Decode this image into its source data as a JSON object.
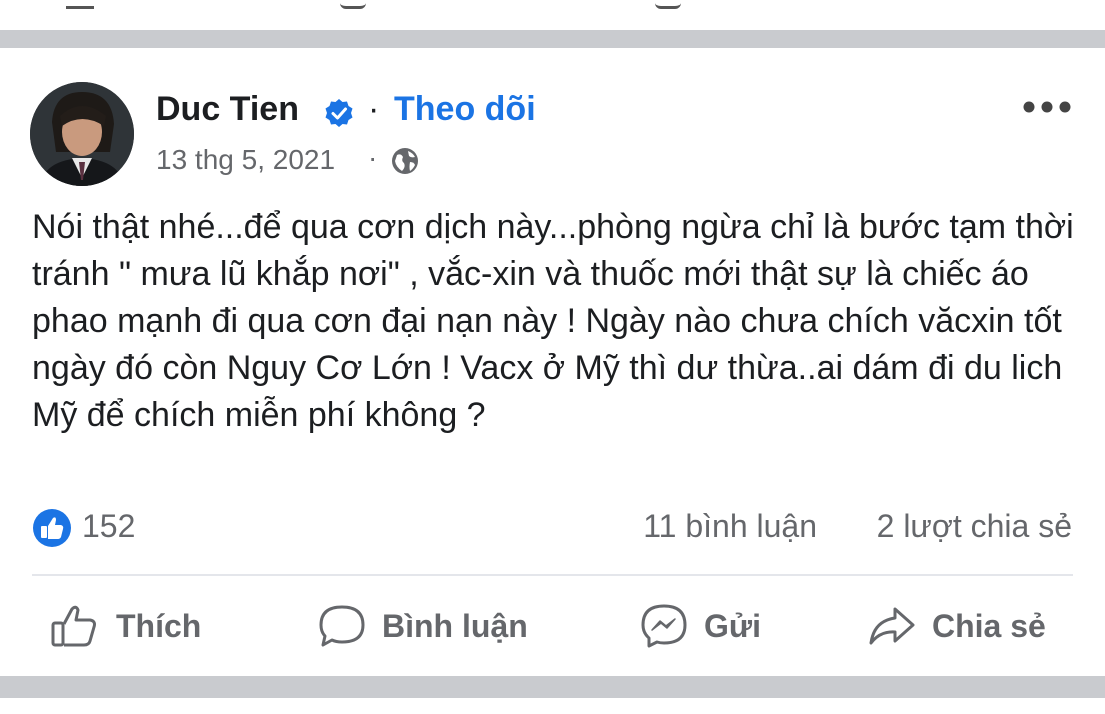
{
  "post": {
    "author": "Duc Tien",
    "follow_separator": "·",
    "follow_label": "Theo dõi",
    "date": "13 thg 5, 2021",
    "date_separator": "·",
    "text": "Nói thật nhé...để qua cơn dịch này...phòng ngừa chỉ là bước tạm thời tránh \" mưa lũ khắp nơi\" , vắc-xin và thuốc mới thật sự là chiếc áo phao mạnh đi qua cơn đại nạn này ! Ngày nào chưa chích văcxin tốt ngày đó còn Nguy Cơ Lớn ! Vacx ở Mỹ thì dư thừa..ai dám đi du lich Mỹ để chích miễn phí không ?",
    "reactions": {
      "icon": "like-icon",
      "count": "152"
    },
    "comments": "11 bình luận",
    "shares": "2 lượt chia sẻ"
  },
  "actions": {
    "like": "Thích",
    "comment": "Bình luận",
    "send": "Gửi",
    "share": "Chia sẻ"
  },
  "icons": {
    "verified": "verified-badge-icon",
    "more": "more-options-icon",
    "audience": "globe-icon",
    "like": "thumbs-up-icon",
    "comment": "comment-bubble-icon",
    "send": "messenger-icon",
    "share": "share-arrow-icon"
  },
  "colors": {
    "accent": "#1b74e4",
    "text": "#1c1e21",
    "muted": "#65676b",
    "divider": "#c9cbcf"
  }
}
